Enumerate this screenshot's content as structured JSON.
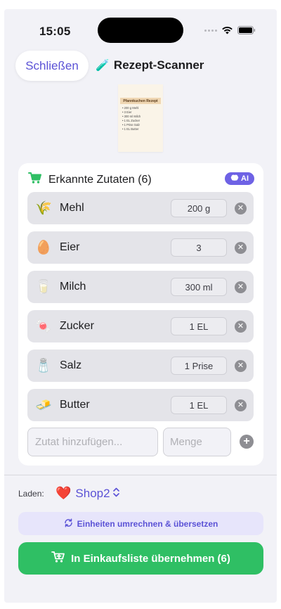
{
  "status_bar": {
    "time": "15:05"
  },
  "header": {
    "close_label": "Schließen",
    "title": "Rezept-Scanner"
  },
  "recipe_image": {
    "title": "Pfannkuchen Rezept",
    "lines": [
      "• 200 g Mehl",
      "• 3 Eier",
      "• 300 ml Milch",
      "• 1 EL Zucker",
      "• 1 Prise Salz",
      "• 1 EL Butter"
    ]
  },
  "ingredients_card": {
    "title": "Erkannte Zutaten (6)",
    "ai_badge": "AI",
    "items": [
      {
        "icon": "🌾",
        "name": "Mehl",
        "quantity": "200 g"
      },
      {
        "icon": "🥚",
        "name": "Eier",
        "quantity": "3"
      },
      {
        "icon": "🥛",
        "name": "Milch",
        "quantity": "300 ml"
      },
      {
        "icon": "🍬",
        "name": "Zucker",
        "quantity": "1 EL"
      },
      {
        "icon": "🧂",
        "name": "Salz",
        "quantity": "1 Prise"
      },
      {
        "icon": "🧈",
        "name": "Butter",
        "quantity": "1 EL"
      }
    ],
    "add_ingredient_placeholder": "Zutat hinzufügen...",
    "add_quantity_placeholder": "Menge"
  },
  "store": {
    "label": "Laden:",
    "icon": "❤️",
    "name": "Shop2"
  },
  "buttons": {
    "convert_label": "Einheiten umrechnen & übersetzen",
    "primary_label": "In Einkaufsliste übernehmen (6)"
  },
  "colors": {
    "accent": "#5b52d6",
    "primary_green": "#2fbf64",
    "ai_badge": "#6e62e5"
  }
}
